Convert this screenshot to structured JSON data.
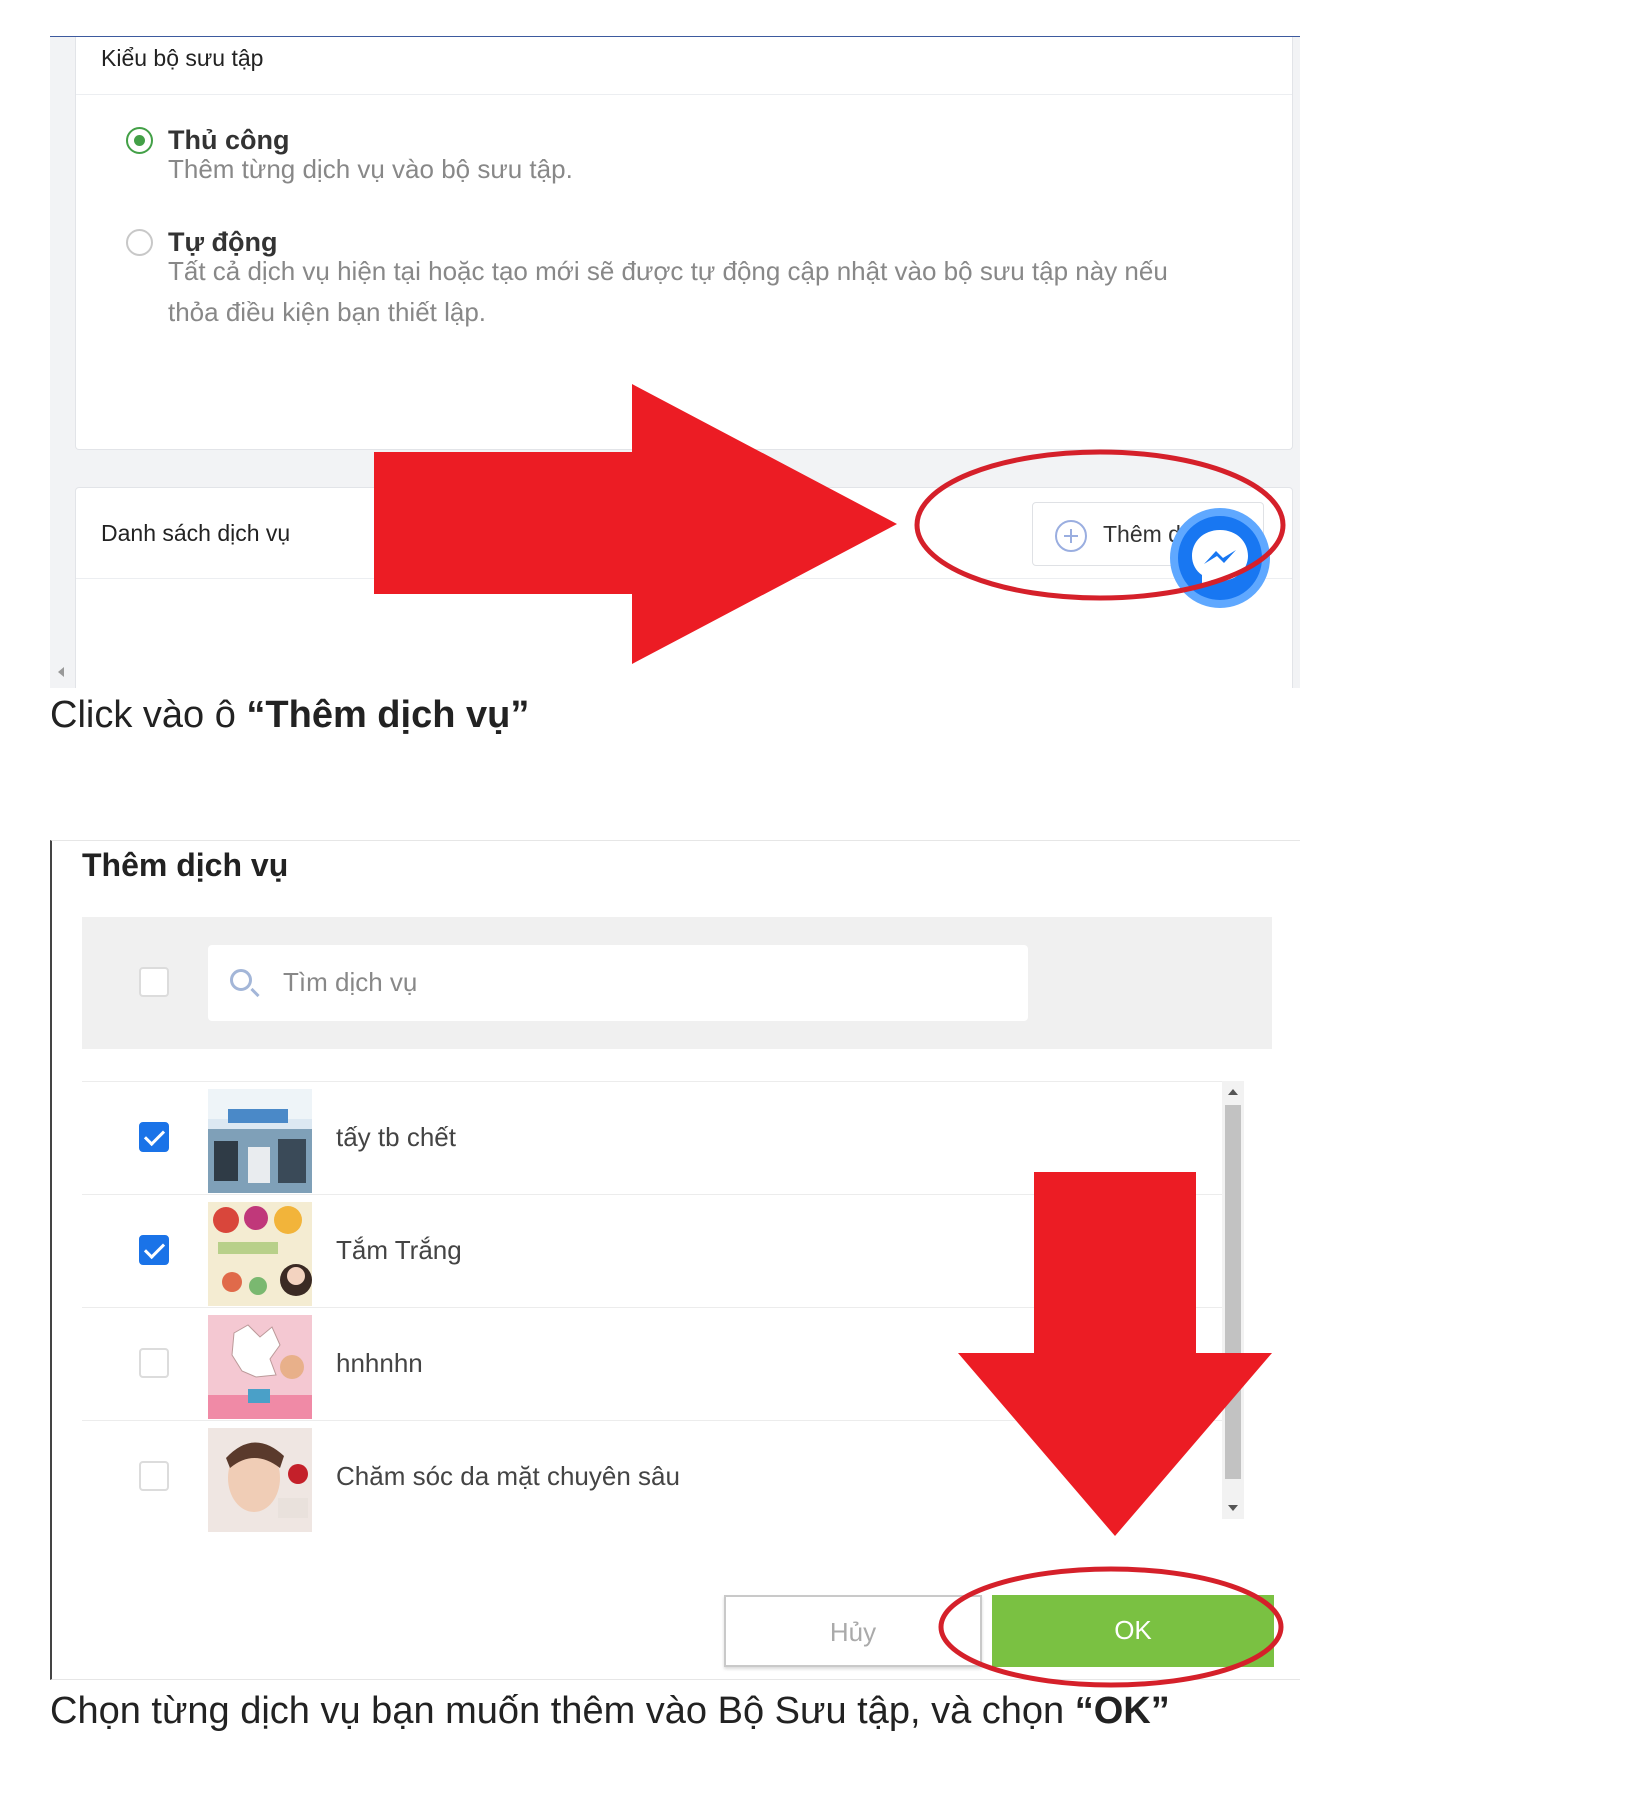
{
  "step1": {
    "collection_type": {
      "header": "Kiểu bộ sưu tập",
      "options": [
        {
          "title": "Thủ công",
          "description": "Thêm từng dịch vụ vào bộ sưu tập.",
          "selected": true
        },
        {
          "title": "Tự động",
          "description": "Tất cả dịch vụ hiện tại hoặc tạo mới sẽ được tự động cập nhật vào bộ sưu tập này nếu thỏa điều kiện bạn thiết lập.",
          "selected": false
        }
      ]
    },
    "service_list": {
      "header": "Danh sách dịch vụ",
      "add_button_label": "Thêm dịch vụ"
    },
    "caption": {
      "prefix": "Click vào ô ",
      "emphasis": "“Thêm dịch vụ”"
    }
  },
  "step2": {
    "dialog_title": "Thêm dịch vụ",
    "search_placeholder": "Tìm dịch vụ",
    "services": [
      {
        "name": "tấy tb chết",
        "checked": true
      },
      {
        "name": "Tắm Trắng",
        "checked": true
      },
      {
        "name": "hnhnhn",
        "checked": false
      },
      {
        "name": "Chăm sóc da mặt chuyên sâu",
        "checked": false
      }
    ],
    "cancel_label": "Hủy",
    "ok_label": "OK",
    "caption": {
      "prefix": "Chọn từng dịch vụ bạn muốn thêm vào Bộ Sưu tập, và chọn ",
      "emphasis": "“OK”"
    }
  },
  "colors": {
    "annotation_red": "#ec1c24",
    "ok_green": "#7ac142",
    "radio_green": "#43a047",
    "checkbox_blue": "#1a73e8",
    "messenger_blue": "#1877f2"
  },
  "icons": [
    "plus-circle-icon",
    "messenger-icon",
    "search-icon",
    "check-icon",
    "arrow-right-annotation",
    "arrow-down-annotation"
  ]
}
